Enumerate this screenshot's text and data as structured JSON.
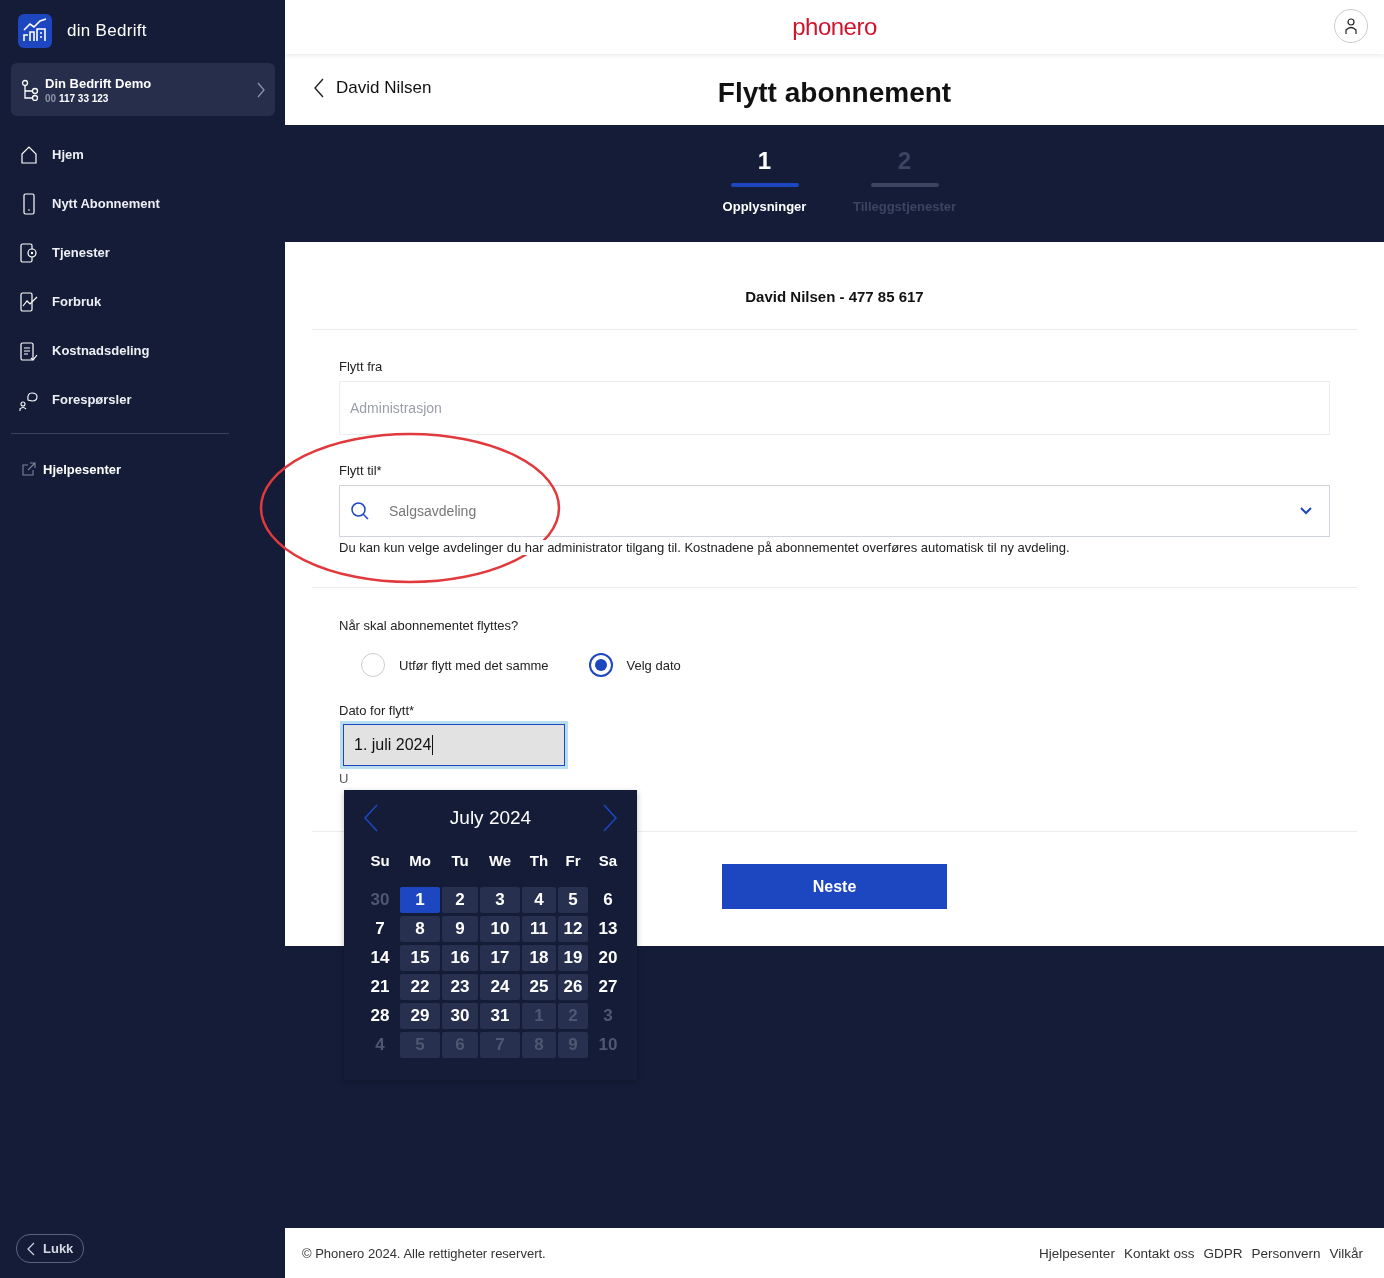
{
  "sidebar": {
    "brand": "din Bedrift",
    "account": {
      "name": "Din Bedrift Demo",
      "number_prefix": "00",
      "number": "117 33 123"
    },
    "items": [
      {
        "label": "Hjem",
        "kind": "home",
        "selected": false
      },
      {
        "label": "Nytt Abonnement",
        "kind": "phone",
        "selected": false
      },
      {
        "label": "Tjenester",
        "kind": "services",
        "selected": false
      },
      {
        "label": "Forbruk",
        "kind": "usage",
        "selected": false
      },
      {
        "label": "Kostnadsdeling",
        "kind": "clipboard",
        "selected": false
      },
      {
        "label": "Forespørsler",
        "kind": "chat",
        "selected": false
      }
    ],
    "help_link": "Hjelpesenter",
    "close_button": "Lukk"
  },
  "header": {
    "logo": "phonero"
  },
  "page": {
    "back_label": "David Nilsen",
    "title": "Flytt abonnement"
  },
  "steps": [
    {
      "number": "1",
      "label": "Opplysninger",
      "selected": true
    },
    {
      "number": "2",
      "label": "Tilleggstjenester",
      "selected": false
    }
  ],
  "form": {
    "subscriber": "David Nilsen - 477 85 617",
    "from_label": "Flytt fra",
    "from_value": "Administrasjon",
    "to_label": "Flytt til*",
    "to_value": "Salgsavdeling",
    "to_hint": "Du kan kun velge avdelinger du har administrator tilgang til. Kostnadene på abonnementet overføres automatisk til ny avdeling.",
    "when_label": "Når skal abonnementet flyttes?",
    "options": [
      {
        "label": "Utfør flytt med det samme",
        "selected": false
      },
      {
        "label": "Velg dato",
        "selected": true
      }
    ],
    "date_label": "Dato for flytt*",
    "date_value": "1. juli 2024",
    "date_hint": "U",
    "next_button": "Neste"
  },
  "calendar": {
    "month": "July 2024",
    "weekdays": [
      "Su",
      "Mo",
      "Tu",
      "We",
      "Th",
      "Fr",
      "Sa"
    ],
    "weeks": [
      [
        {
          "day": "30",
          "kind": "other",
          "selected": false
        },
        {
          "day": "1",
          "kind": "month",
          "selected": true
        },
        {
          "day": "2",
          "kind": "month",
          "selected": false
        },
        {
          "day": "3",
          "kind": "month",
          "selected": false
        },
        {
          "day": "4",
          "kind": "month",
          "selected": false
        },
        {
          "day": "5",
          "kind": "month",
          "selected": false
        },
        {
          "day": "6",
          "kind": "month",
          "selected": false
        }
      ],
      [
        {
          "day": "7",
          "kind": "month",
          "selected": false
        },
        {
          "day": "8",
          "kind": "month",
          "selected": false
        },
        {
          "day": "9",
          "kind": "month",
          "selected": false
        },
        {
          "day": "10",
          "kind": "month",
          "selected": false
        },
        {
          "day": "11",
          "kind": "month",
          "selected": false
        },
        {
          "day": "12",
          "kind": "month",
          "selected": false
        },
        {
          "day": "13",
          "kind": "month",
          "selected": false
        }
      ],
      [
        {
          "day": "14",
          "kind": "month",
          "selected": false
        },
        {
          "day": "15",
          "kind": "month",
          "selected": false
        },
        {
          "day": "16",
          "kind": "month",
          "selected": false
        },
        {
          "day": "17",
          "kind": "month",
          "selected": false
        },
        {
          "day": "18",
          "kind": "month",
          "selected": false
        },
        {
          "day": "19",
          "kind": "month",
          "selected": false
        },
        {
          "day": "20",
          "kind": "month",
          "selected": false
        }
      ],
      [
        {
          "day": "21",
          "kind": "month",
          "selected": false
        },
        {
          "day": "22",
          "kind": "month",
          "selected": false
        },
        {
          "day": "23",
          "kind": "month",
          "selected": false
        },
        {
          "day": "24",
          "kind": "month",
          "selected": false
        },
        {
          "day": "25",
          "kind": "month",
          "selected": false
        },
        {
          "day": "26",
          "kind": "month",
          "selected": false
        },
        {
          "day": "27",
          "kind": "month",
          "selected": false
        }
      ],
      [
        {
          "day": "28",
          "kind": "month",
          "selected": false
        },
        {
          "day": "29",
          "kind": "month",
          "selected": false
        },
        {
          "day": "30",
          "kind": "month",
          "selected": false
        },
        {
          "day": "31",
          "kind": "month",
          "selected": false
        },
        {
          "day": "1",
          "kind": "other",
          "selected": false
        },
        {
          "day": "2",
          "kind": "other",
          "selected": false
        },
        {
          "day": "3",
          "kind": "other",
          "selected": false
        }
      ],
      [
        {
          "day": "4",
          "kind": "other",
          "selected": false
        },
        {
          "day": "5",
          "kind": "other",
          "selected": false
        },
        {
          "day": "6",
          "kind": "other",
          "selected": false
        },
        {
          "day": "7",
          "kind": "other",
          "selected": false
        },
        {
          "day": "8",
          "kind": "other",
          "selected": false
        },
        {
          "day": "9",
          "kind": "other",
          "selected": false
        },
        {
          "day": "10",
          "kind": "other",
          "selected": false
        }
      ]
    ]
  },
  "annotation": {
    "kind": "ellipse"
  },
  "footer": {
    "copyright": "© Phonero 2024. Alle rettigheter reservert.",
    "links": [
      "Hjelpesenter",
      "Kontakt oss",
      "GDPR",
      "Personvern",
      "Vilkår"
    ]
  }
}
